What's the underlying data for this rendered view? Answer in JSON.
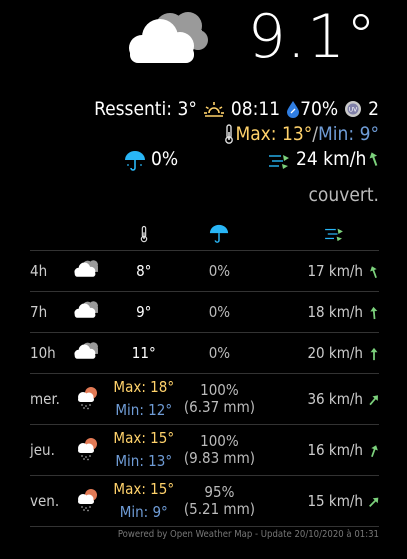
{
  "current": {
    "temperature": "9.1°",
    "feels_like_label": "Ressenti: 3°",
    "sunrise": "08:11",
    "humidity": "70%",
    "uv": "2",
    "max": "Max: 13°",
    "separator": "/",
    "min": "Min: 9°",
    "precipitation": "0%",
    "wind": "24 km/h",
    "condition": "couvert."
  },
  "hourly": [
    {
      "time": "4h",
      "temp": "8°",
      "rain": "0%",
      "wind": "17 km/h"
    },
    {
      "time": "7h",
      "temp": "9°",
      "rain": "0%",
      "wind": "18 km/h"
    },
    {
      "time": "10h",
      "temp": "11°",
      "rain": "0%",
      "wind": "20 km/h"
    }
  ],
  "daily": [
    {
      "day": "mer.",
      "max": "Max: 18°",
      "min": "Min: 12°",
      "rain_pct": "100%",
      "rain_mm": "(6.37 mm)",
      "wind": "36 km/h"
    },
    {
      "day": "jeu.",
      "max": "Max: 15°",
      "min": "Min: 13°",
      "rain_pct": "100%",
      "rain_mm": "(9.83 mm)",
      "wind": "16 km/h"
    },
    {
      "day": "ven.",
      "max": "Max: 15°",
      "min": "Min: 9°",
      "rain_pct": "95%",
      "rain_mm": "(5.21 mm)",
      "wind": "15 km/h"
    }
  ],
  "footer": "Powered by Open Weather Map - Update 20/10/2020 à 01:31",
  "colors": {
    "max": "#ffd26b",
    "min": "#6f9cd6",
    "wind_arrow": "#7cd17c",
    "umbrella": "#29b6f6"
  },
  "icons": [
    "cloudy-icon",
    "sun-icon",
    "droplet-icon",
    "uv-icon",
    "thermometer-icon",
    "umbrella-icon",
    "wind-icon",
    "arrow-icon",
    "rain-cloud-icon"
  ]
}
